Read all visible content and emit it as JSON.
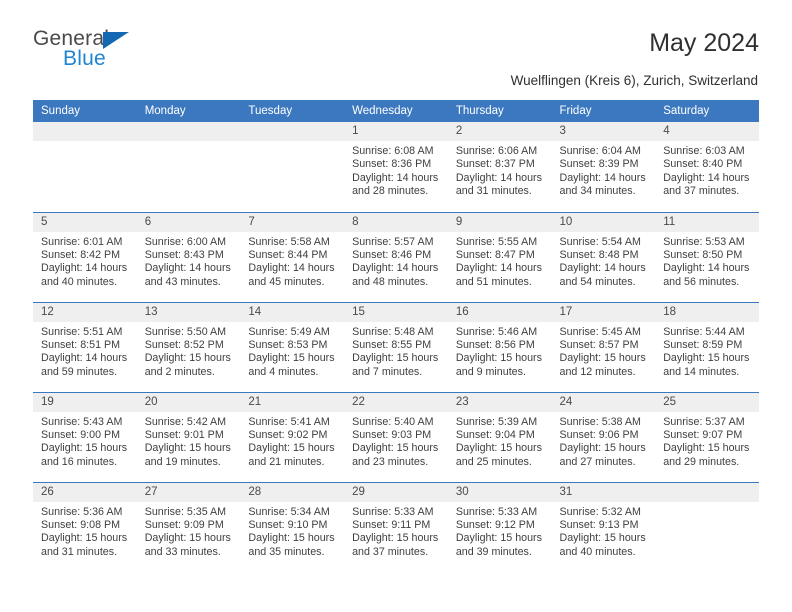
{
  "brand": {
    "name_part1": "General",
    "name_part2": "Blue",
    "accent_color": "#1268b3",
    "blue_text_color": "#1f85d0"
  },
  "header": {
    "month_title": "May 2024",
    "location": "Wuelflingen (Kreis 6), Zurich, Switzerland",
    "header_bg_color": "#3c78c0",
    "daynum_bg_color": "#efefef"
  },
  "calendar": {
    "weekday_headers": [
      "Sunday",
      "Monday",
      "Tuesday",
      "Wednesday",
      "Thursday",
      "Friday",
      "Saturday"
    ],
    "labels": {
      "sunrise": "Sunrise:",
      "sunset": "Sunset:",
      "daylight": "Daylight:"
    },
    "weeks": [
      [
        {
          "day": "",
          "empty": true
        },
        {
          "day": "",
          "empty": true
        },
        {
          "day": "",
          "empty": true
        },
        {
          "day": "1",
          "sunrise": "Sunrise: 6:08 AM",
          "sunset": "Sunset: 8:36 PM",
          "daylight_line1": "Daylight: 14 hours",
          "daylight_line2": "and 28 minutes."
        },
        {
          "day": "2",
          "sunrise": "Sunrise: 6:06 AM",
          "sunset": "Sunset: 8:37 PM",
          "daylight_line1": "Daylight: 14 hours",
          "daylight_line2": "and 31 minutes."
        },
        {
          "day": "3",
          "sunrise": "Sunrise: 6:04 AM",
          "sunset": "Sunset: 8:39 PM",
          "daylight_line1": "Daylight: 14 hours",
          "daylight_line2": "and 34 minutes."
        },
        {
          "day": "4",
          "sunrise": "Sunrise: 6:03 AM",
          "sunset": "Sunset: 8:40 PM",
          "daylight_line1": "Daylight: 14 hours",
          "daylight_line2": "and 37 minutes."
        }
      ],
      [
        {
          "day": "5",
          "sunrise": "Sunrise: 6:01 AM",
          "sunset": "Sunset: 8:42 PM",
          "daylight_line1": "Daylight: 14 hours",
          "daylight_line2": "and 40 minutes."
        },
        {
          "day": "6",
          "sunrise": "Sunrise: 6:00 AM",
          "sunset": "Sunset: 8:43 PM",
          "daylight_line1": "Daylight: 14 hours",
          "daylight_line2": "and 43 minutes."
        },
        {
          "day": "7",
          "sunrise": "Sunrise: 5:58 AM",
          "sunset": "Sunset: 8:44 PM",
          "daylight_line1": "Daylight: 14 hours",
          "daylight_line2": "and 45 minutes."
        },
        {
          "day": "8",
          "sunrise": "Sunrise: 5:57 AM",
          "sunset": "Sunset: 8:46 PM",
          "daylight_line1": "Daylight: 14 hours",
          "daylight_line2": "and 48 minutes."
        },
        {
          "day": "9",
          "sunrise": "Sunrise: 5:55 AM",
          "sunset": "Sunset: 8:47 PM",
          "daylight_line1": "Daylight: 14 hours",
          "daylight_line2": "and 51 minutes."
        },
        {
          "day": "10",
          "sunrise": "Sunrise: 5:54 AM",
          "sunset": "Sunset: 8:48 PM",
          "daylight_line1": "Daylight: 14 hours",
          "daylight_line2": "and 54 minutes."
        },
        {
          "day": "11",
          "sunrise": "Sunrise: 5:53 AM",
          "sunset": "Sunset: 8:50 PM",
          "daylight_line1": "Daylight: 14 hours",
          "daylight_line2": "and 56 minutes."
        }
      ],
      [
        {
          "day": "12",
          "sunrise": "Sunrise: 5:51 AM",
          "sunset": "Sunset: 8:51 PM",
          "daylight_line1": "Daylight: 14 hours",
          "daylight_line2": "and 59 minutes."
        },
        {
          "day": "13",
          "sunrise": "Sunrise: 5:50 AM",
          "sunset": "Sunset: 8:52 PM",
          "daylight_line1": "Daylight: 15 hours",
          "daylight_line2": "and 2 minutes."
        },
        {
          "day": "14",
          "sunrise": "Sunrise: 5:49 AM",
          "sunset": "Sunset: 8:53 PM",
          "daylight_line1": "Daylight: 15 hours",
          "daylight_line2": "and 4 minutes."
        },
        {
          "day": "15",
          "sunrise": "Sunrise: 5:48 AM",
          "sunset": "Sunset: 8:55 PM",
          "daylight_line1": "Daylight: 15 hours",
          "daylight_line2": "and 7 minutes."
        },
        {
          "day": "16",
          "sunrise": "Sunrise: 5:46 AM",
          "sunset": "Sunset: 8:56 PM",
          "daylight_line1": "Daylight: 15 hours",
          "daylight_line2": "and 9 minutes."
        },
        {
          "day": "17",
          "sunrise": "Sunrise: 5:45 AM",
          "sunset": "Sunset: 8:57 PM",
          "daylight_line1": "Daylight: 15 hours",
          "daylight_line2": "and 12 minutes."
        },
        {
          "day": "18",
          "sunrise": "Sunrise: 5:44 AM",
          "sunset": "Sunset: 8:59 PM",
          "daylight_line1": "Daylight: 15 hours",
          "daylight_line2": "and 14 minutes."
        }
      ],
      [
        {
          "day": "19",
          "sunrise": "Sunrise: 5:43 AM",
          "sunset": "Sunset: 9:00 PM",
          "daylight_line1": "Daylight: 15 hours",
          "daylight_line2": "and 16 minutes."
        },
        {
          "day": "20",
          "sunrise": "Sunrise: 5:42 AM",
          "sunset": "Sunset: 9:01 PM",
          "daylight_line1": "Daylight: 15 hours",
          "daylight_line2": "and 19 minutes."
        },
        {
          "day": "21",
          "sunrise": "Sunrise: 5:41 AM",
          "sunset": "Sunset: 9:02 PM",
          "daylight_line1": "Daylight: 15 hours",
          "daylight_line2": "and 21 minutes."
        },
        {
          "day": "22",
          "sunrise": "Sunrise: 5:40 AM",
          "sunset": "Sunset: 9:03 PM",
          "daylight_line1": "Daylight: 15 hours",
          "daylight_line2": "and 23 minutes."
        },
        {
          "day": "23",
          "sunrise": "Sunrise: 5:39 AM",
          "sunset": "Sunset: 9:04 PM",
          "daylight_line1": "Daylight: 15 hours",
          "daylight_line2": "and 25 minutes."
        },
        {
          "day": "24",
          "sunrise": "Sunrise: 5:38 AM",
          "sunset": "Sunset: 9:06 PM",
          "daylight_line1": "Daylight: 15 hours",
          "daylight_line2": "and 27 minutes."
        },
        {
          "day": "25",
          "sunrise": "Sunrise: 5:37 AM",
          "sunset": "Sunset: 9:07 PM",
          "daylight_line1": "Daylight: 15 hours",
          "daylight_line2": "and 29 minutes."
        }
      ],
      [
        {
          "day": "26",
          "sunrise": "Sunrise: 5:36 AM",
          "sunset": "Sunset: 9:08 PM",
          "daylight_line1": "Daylight: 15 hours",
          "daylight_line2": "and 31 minutes."
        },
        {
          "day": "27",
          "sunrise": "Sunrise: 5:35 AM",
          "sunset": "Sunset: 9:09 PM",
          "daylight_line1": "Daylight: 15 hours",
          "daylight_line2": "and 33 minutes."
        },
        {
          "day": "28",
          "sunrise": "Sunrise: 5:34 AM",
          "sunset": "Sunset: 9:10 PM",
          "daylight_line1": "Daylight: 15 hours",
          "daylight_line2": "and 35 minutes."
        },
        {
          "day": "29",
          "sunrise": "Sunrise: 5:33 AM",
          "sunset": "Sunset: 9:11 PM",
          "daylight_line1": "Daylight: 15 hours",
          "daylight_line2": "and 37 minutes."
        },
        {
          "day": "30",
          "sunrise": "Sunrise: 5:33 AM",
          "sunset": "Sunset: 9:12 PM",
          "daylight_line1": "Daylight: 15 hours",
          "daylight_line2": "and 39 minutes."
        },
        {
          "day": "31",
          "sunrise": "Sunrise: 5:32 AM",
          "sunset": "Sunset: 9:13 PM",
          "daylight_line1": "Daylight: 15 hours",
          "daylight_line2": "and 40 minutes."
        },
        {
          "day": "",
          "empty": true
        }
      ]
    ]
  }
}
